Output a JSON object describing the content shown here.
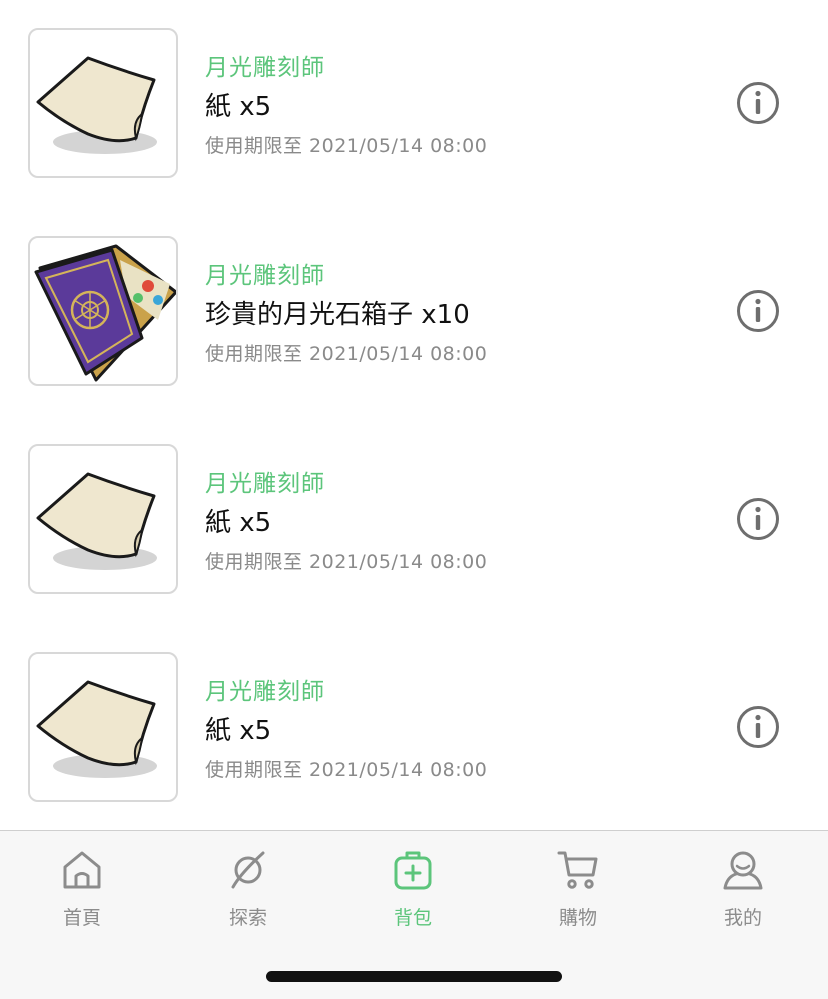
{
  "items": [
    {
      "source": "月光雕刻師",
      "name": "紙 x5",
      "expiry": "使用期限至 2021/05/14 08:00",
      "thumbnail": "paper",
      "info_icon": "info-icon"
    },
    {
      "source": "月光雕刻師",
      "name": "珍貴的月光石箱子 x10",
      "expiry": "使用期限至 2021/05/14 08:00",
      "thumbnail": "moonstone-box",
      "info_icon": "info-icon"
    },
    {
      "source": "月光雕刻師",
      "name": "紙 x5",
      "expiry": "使用期限至 2021/05/14 08:00",
      "thumbnail": "paper",
      "info_icon": "info-icon"
    },
    {
      "source": "月光雕刻師",
      "name": "紙 x5",
      "expiry": "使用期限至 2021/05/14 08:00",
      "thumbnail": "paper",
      "info_icon": "info-icon"
    }
  ],
  "tabbar": {
    "tabs": [
      {
        "label": "首頁",
        "icon": "home-icon",
        "active": false
      },
      {
        "label": "探索",
        "icon": "planet-icon",
        "active": false
      },
      {
        "label": "背包",
        "icon": "backpack-icon",
        "active": true
      },
      {
        "label": "購物",
        "icon": "cart-icon",
        "active": false
      },
      {
        "label": "我的",
        "icon": "profile-icon",
        "active": false
      }
    ]
  },
  "colors": {
    "accent": "#5cc57b",
    "text": "#111111",
    "secondary": "#8a8a8a",
    "inactive_tab": "#8c8c8c"
  }
}
